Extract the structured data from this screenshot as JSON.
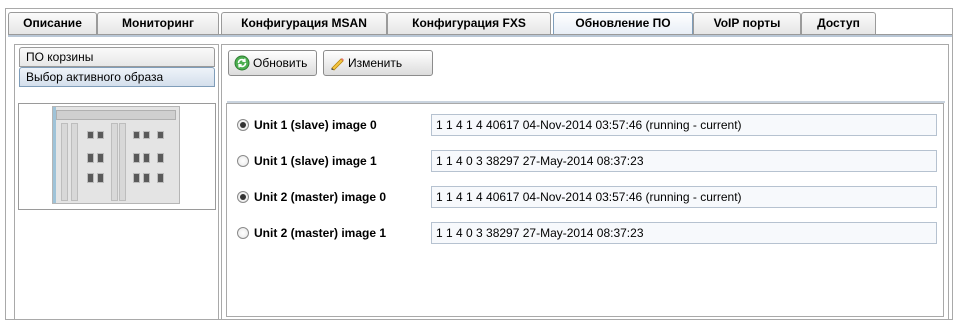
{
  "tabs": [
    {
      "label": "Описание"
    },
    {
      "label": "Мониторинг"
    },
    {
      "label": "Конфигурация MSAN"
    },
    {
      "label": "Конфигурация FXS"
    },
    {
      "label": "Обновление ПО"
    },
    {
      "label": "VoIP порты"
    },
    {
      "label": "Доступ"
    }
  ],
  "active_tab": "Обновление ПО",
  "sidebar": {
    "items": [
      {
        "label": "ПО корзины"
      },
      {
        "label": "Выбор активного образа"
      }
    ],
    "active_item": "Выбор активного образа",
    "image_icon": "chassis-image"
  },
  "toolbar": {
    "refresh_label": "Обновить",
    "edit_label": "Изменить",
    "refresh_icon": "refresh-icon",
    "edit_icon": "pencil-icon"
  },
  "images": [
    {
      "label": "Unit 1 (slave)  image 0",
      "value": "1 1 4 1 4 40617 04-Nov-2014  03:57:46 (running - current)",
      "checked": true
    },
    {
      "label": "Unit 1 (slave)  image 1",
      "value": "1 1 4 0 3 38297 27-May-2014  08:37:23",
      "checked": false
    },
    {
      "label": "Unit 2 (master) image 0",
      "value": "1 1 4 1 4 40617 04-Nov-2014  03:57:46 (running - current)",
      "checked": true
    },
    {
      "label": "Unit 2 (master) image 1",
      "value": "1 1 4 0 3 38297 27-May-2014  08:37:23",
      "checked": false
    }
  ]
}
